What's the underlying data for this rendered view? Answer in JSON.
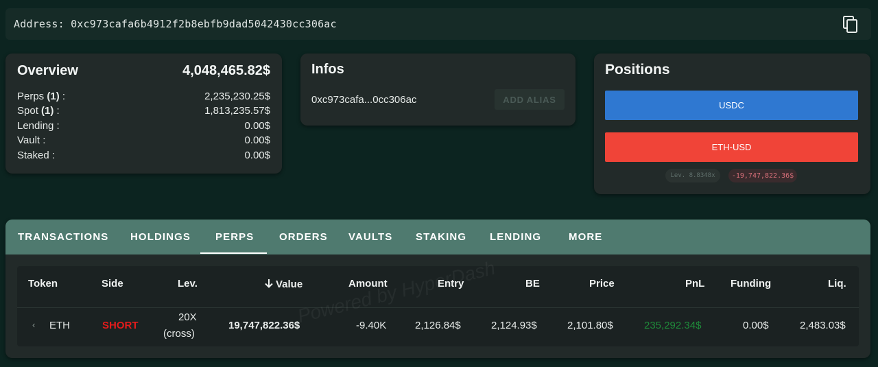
{
  "address_bar": {
    "label": "Address: 0xc973cafa6b4912f2b8ebfb9dad5042430cc306ac",
    "copy_icon": "copy-icon"
  },
  "overview": {
    "title": "Overview",
    "total": "4,048,465.82$",
    "rows": [
      {
        "label": "Perps",
        "count": "(1)",
        "suffix": " :",
        "value": "2,235,230.25$"
      },
      {
        "label": "Spot",
        "count": "(1)",
        "suffix": " :",
        "value": "1,813,235.57$"
      },
      {
        "label": "Lending :",
        "count": "",
        "suffix": "",
        "value": "0.00$"
      },
      {
        "label": "Vault :",
        "count": "",
        "suffix": "",
        "value": "0.00$"
      },
      {
        "label": "Staked :",
        "count": "",
        "suffix": "",
        "value": "0.00$"
      }
    ]
  },
  "infos": {
    "title": "Infos",
    "short_address": "0xc973cafa...0cc306ac",
    "alias_button": "ADD ALIAS"
  },
  "positions": {
    "title": "Positions",
    "bars": [
      {
        "label": "USDC",
        "color": "#2f78d1"
      },
      {
        "label": "ETH-USD",
        "color": "#f04438"
      }
    ],
    "lev_chip": "Lev. 8.8348x",
    "pnl_chip": "-19,747,822.36$"
  },
  "tabs": {
    "items": [
      "TRANSACTIONS",
      "HOLDINGS",
      "PERPS",
      "ORDERS",
      "VAULTS",
      "STAKING",
      "LENDING",
      "MORE"
    ],
    "active": "PERPS"
  },
  "table": {
    "headers": {
      "token": "Token",
      "side": "Side",
      "lev": "Lev.",
      "value": "Value",
      "amount": "Amount",
      "entry": "Entry",
      "be": "BE",
      "price": "Price",
      "pnl": "PnL",
      "funding": "Funding",
      "liq": "Liq."
    },
    "sort_icon": "arrow-down-icon",
    "rows": [
      {
        "token": "ETH",
        "side": "SHORT",
        "lev_line1": "20X",
        "lev_line2": "(cross)",
        "value": "19,747,822.36$",
        "amount": "-9.40K",
        "entry": "2,126.84$",
        "be": "2,124.93$",
        "price": "2,101.80$",
        "pnl": "235,292.34$",
        "funding": "0.00$",
        "liq": "2,483.03$"
      }
    ]
  },
  "watermark": "Powered by HyperDash",
  "colors": {
    "short": "#e31b1b",
    "pnl_positive": "#1f8a3a",
    "tab_bar": "#4f7a6f"
  }
}
